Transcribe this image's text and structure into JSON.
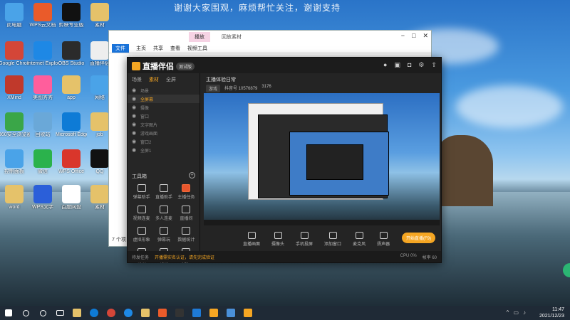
{
  "banner": "谢谢大家围观，麻烦帮忙关注，谢谢支持",
  "desktop_icons": [
    {
      "label": "此电脑",
      "color": "#4aa3e8"
    },
    {
      "label": "WPS云文档",
      "color": "#ea5b2a"
    },
    {
      "label": "剪映专业版",
      "color": "#111111"
    },
    {
      "label": "素材",
      "color": "#e5c26a"
    },
    {
      "label": "Google Chrome",
      "color": "#d44638"
    },
    {
      "label": "Internet Explorer",
      "color": "#1e88e5"
    },
    {
      "label": "OBS Studio",
      "color": "#2b2b2b"
    },
    {
      "label": "直播伴侣",
      "color": "#eeeeee"
    },
    {
      "label": "XMind",
      "color": "#c0392b"
    },
    {
      "label": "美图秀秀",
      "color": "#ff5e9c"
    },
    {
      "label": "app",
      "color": "#e5c26a"
    },
    {
      "label": "网络",
      "color": "#4aa3e8"
    },
    {
      "label": "360安全浏览器",
      "color": "#3aa648"
    },
    {
      "label": "回收站",
      "color": "#6aa8d8"
    },
    {
      "label": "Microsoft Edge",
      "color": "#0e7bd6"
    },
    {
      "label": "job",
      "color": "#e5c26a"
    },
    {
      "label": "控制面板",
      "color": "#4aa3e8"
    },
    {
      "label": "微信",
      "color": "#2bb24c"
    },
    {
      "label": "WPS Office",
      "color": "#d9362b"
    },
    {
      "label": "QQ",
      "color": "#111111"
    },
    {
      "label": "word",
      "color": "#e5c26a"
    },
    {
      "label": "WPS文字",
      "color": "#2b5fd9"
    },
    {
      "label": "百度网盘",
      "color": "#ffffff"
    },
    {
      "label": "素材",
      "color": "#e5c26a"
    }
  ],
  "explorer": {
    "manage_tab": "播放",
    "title": "回放素材",
    "ribbon": [
      "文件",
      "主页",
      "共享",
      "查看",
      "视频工具"
    ],
    "count": "7 个项目"
  },
  "app": {
    "name": "直播伴侣",
    "badge": "测试版",
    "left_tabs": [
      "场景",
      "素材",
      "全屏"
    ],
    "scenes": [
      {
        "label": "场景",
        "selected": false
      },
      {
        "label": "全屏幕",
        "selected": true
      },
      {
        "label": "摄像",
        "selected": false
      },
      {
        "label": "窗口",
        "selected": false
      },
      {
        "label": "文字图片",
        "selected": false
      },
      {
        "label": "游戏画面",
        "selected": false
      },
      {
        "label": "窗口2",
        "selected": false
      },
      {
        "label": "全屏1",
        "selected": false
      }
    ],
    "tools_title": "工具箱",
    "tools": [
      {
        "label": "弹幕助手",
        "red": false
      },
      {
        "label": "直播助手",
        "red": false
      },
      {
        "label": "主播任务",
        "red": true
      },
      {
        "label": "视频连麦",
        "red": false
      },
      {
        "label": "多人连麦",
        "red": false
      },
      {
        "label": "直播间",
        "red": false
      },
      {
        "label": "虚拟形象",
        "red": false
      },
      {
        "label": "弹幕玩",
        "red": false
      },
      {
        "label": "数据统计",
        "red": false
      },
      {
        "label": "特效",
        "red": false
      },
      {
        "label": "礼物",
        "red": false
      },
      {
        "label": "更多",
        "red": false
      }
    ],
    "live_title": "主播体验日常",
    "live_tag": "游戏",
    "live_room": "抖音号 10576879",
    "live_count": "3176",
    "bottom_buttons": [
      "直播画面",
      "摄像头",
      "手机投屏",
      "添加窗口",
      "麦克风",
      "扬声器"
    ],
    "start_live": "开始直播(F9)",
    "status": {
      "left": "待发任务",
      "highlight": "开播需实名认证，请先完成验证",
      "right": [
        "CPU 0%",
        "帧率 60"
      ]
    }
  },
  "taskbar": {
    "time": "11:47",
    "date": "2021/12/23"
  }
}
